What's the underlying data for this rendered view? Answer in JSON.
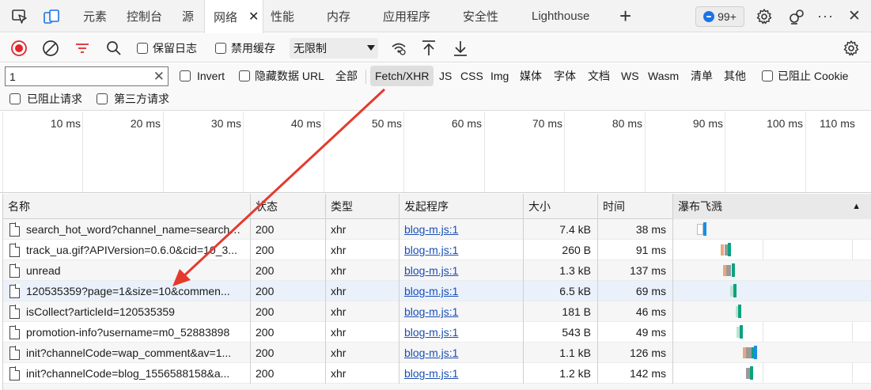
{
  "tabs": {
    "elements": "元素",
    "console": "控制台",
    "sources": "源",
    "network": "网络",
    "close": "✕",
    "performance": "性能",
    "memory": "内存",
    "application": "应用程序",
    "security": "安全性",
    "lighthouse": "Lighthouse",
    "add": "+",
    "issues_count": "99+",
    "more": "···",
    "close_devtools": "✕"
  },
  "toolbar": {
    "preserve_log": "保留日志",
    "disable_cache": "禁用缓存",
    "throttling": "无限制"
  },
  "filter": {
    "value": "1",
    "clear": "✕",
    "invert": "Invert",
    "hide_data_urls": "隐藏数据 URL",
    "types": [
      "全部",
      "Fetch/XHR",
      "JS",
      "CSS",
      "Img",
      "媒体",
      "字体",
      "文档",
      "WS",
      "Wasm",
      "清单",
      "其他"
    ],
    "active_type": "Fetch/XHR",
    "blocked_cookies": "已阻止 Cookie",
    "blocked_requests": "已阻止请求",
    "third_party": "第三方请求"
  },
  "overview": {
    "ticks": [
      "10 ms",
      "20 ms",
      "30 ms",
      "40 ms",
      "50 ms",
      "60 ms",
      "70 ms",
      "80 ms",
      "90 ms",
      "100 ms",
      "110 ms"
    ]
  },
  "table": {
    "headers": {
      "name": "名称",
      "status": "状态",
      "type": "类型",
      "initiator": "发起程序",
      "size": "大小",
      "time": "时间",
      "waterfall": "瀑布飞溅",
      "sort": "▲"
    },
    "rows": [
      {
        "name": "search_hot_word?channel_name=search_...",
        "status": "200",
        "type": "xhr",
        "initiator": "blog-m.js:1",
        "size": "7.4 kB",
        "time": "38 ms"
      },
      {
        "name": "track_ua.gif?APIVersion=0.6.0&cid=10_3...",
        "status": "200",
        "type": "xhr",
        "initiator": "blog-m.js:1",
        "size": "260 B",
        "time": "91 ms"
      },
      {
        "name": "unread",
        "status": "200",
        "type": "xhr",
        "initiator": "blog-m.js:1",
        "size": "1.3 kB",
        "time": "137 ms"
      },
      {
        "name": "120535359?page=1&size=10&commen...",
        "status": "200",
        "type": "xhr",
        "initiator": "blog-m.js:1",
        "size": "6.5 kB",
        "time": "69 ms"
      },
      {
        "name": "isCollect?articleId=120535359",
        "status": "200",
        "type": "xhr",
        "initiator": "blog-m.js:1",
        "size": "181 B",
        "time": "46 ms"
      },
      {
        "name": "promotion-info?username=m0_52883898",
        "status": "200",
        "type": "xhr",
        "initiator": "blog-m.js:1",
        "size": "543 B",
        "time": "49 ms"
      },
      {
        "name": "init?channelCode=wap_comment&av=1...",
        "status": "200",
        "type": "xhr",
        "initiator": "blog-m.js:1",
        "size": "1.1 kB",
        "time": "126 ms"
      },
      {
        "name": "init?channelCode=blog_1556588158&a...",
        "status": "200",
        "type": "xhr",
        "initiator": "blog-m.js:1",
        "size": "1.2 kB",
        "time": "142 ms"
      }
    ]
  },
  "colors": {
    "record": "#e0262b",
    "filter_icon": "#e0262b",
    "accent_blue": "#1a73e8",
    "link": "#1a4fb5",
    "annotation_arrow": "#e5392f",
    "waterfall_blue": "#1a8fe0",
    "waterfall_teal": "#0ba37f"
  },
  "icons": [
    "inspect-icon",
    "device-icon",
    "gear-icon",
    "customize-icon",
    "record-icon",
    "clear-icon",
    "filter-icon",
    "search-icon",
    "network-conditions-icon",
    "upload-icon",
    "download-icon",
    "settings-icon",
    "document-icon"
  ]
}
